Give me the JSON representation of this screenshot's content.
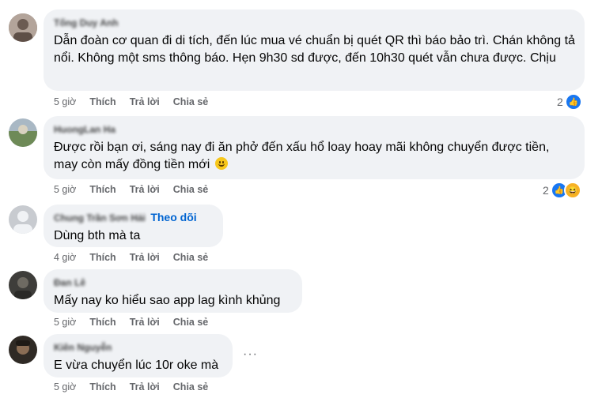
{
  "comments": [
    {
      "author": "Tống Duy Anh",
      "text": "Dẫn đoàn cơ quan đi di tích, đến lúc mua vé chuẩn bị quét QR thì báo bảo trì. Chán không tả nổi. Không một sms thông báo. Hẹn 9h30 sd được, đến 10h30 quét vẫn chưa được. Chịu",
      "time": "5 giờ",
      "like": "Thích",
      "reply": "Trả lời",
      "share": "Chia sẻ",
      "reaction_count": "2",
      "reactions": [
        "like-icon"
      ],
      "avatar_color": "#8a7a70"
    },
    {
      "author": "HuongLan Ha",
      "text": "Được rồi bạn ơi, sáng nay đi ăn phở đến xấu hổ loay hoay mãi không chuyển được tiền, may còn mấy đồng tiền mới",
      "time": "5 giờ",
      "like": "Thích",
      "reply": "Trả lời",
      "share": "Chia sẻ",
      "reaction_count": "2",
      "reactions": [
        "like-icon",
        "haha-icon"
      ],
      "avatar_color": "#7f9a6a"
    },
    {
      "author": "Chung Trần Sơn Hải",
      "follow": "Theo dõi",
      "text": "Dùng bth mà ta",
      "time": "4 giờ",
      "like": "Thích",
      "reply": "Trả lời",
      "share": "Chia sẻ",
      "avatar_color": "#c8cbd0"
    },
    {
      "author": "Đan Lê",
      "text": "Mấy nay ko hiểu sao app lag kình khủng",
      "time": "5 giờ",
      "like": "Thích",
      "reply": "Trả lời",
      "share": "Chia sẻ",
      "avatar_color": "#4a4a48"
    },
    {
      "author": "Kiên Nguyễn",
      "text": "E vừa chuyển lúc 10r oke mà",
      "time": "5 giờ",
      "like": "Thích",
      "reply": "Trả lời",
      "share": "Chia sẻ",
      "more": "···",
      "avatar_color": "#3a3530"
    }
  ]
}
